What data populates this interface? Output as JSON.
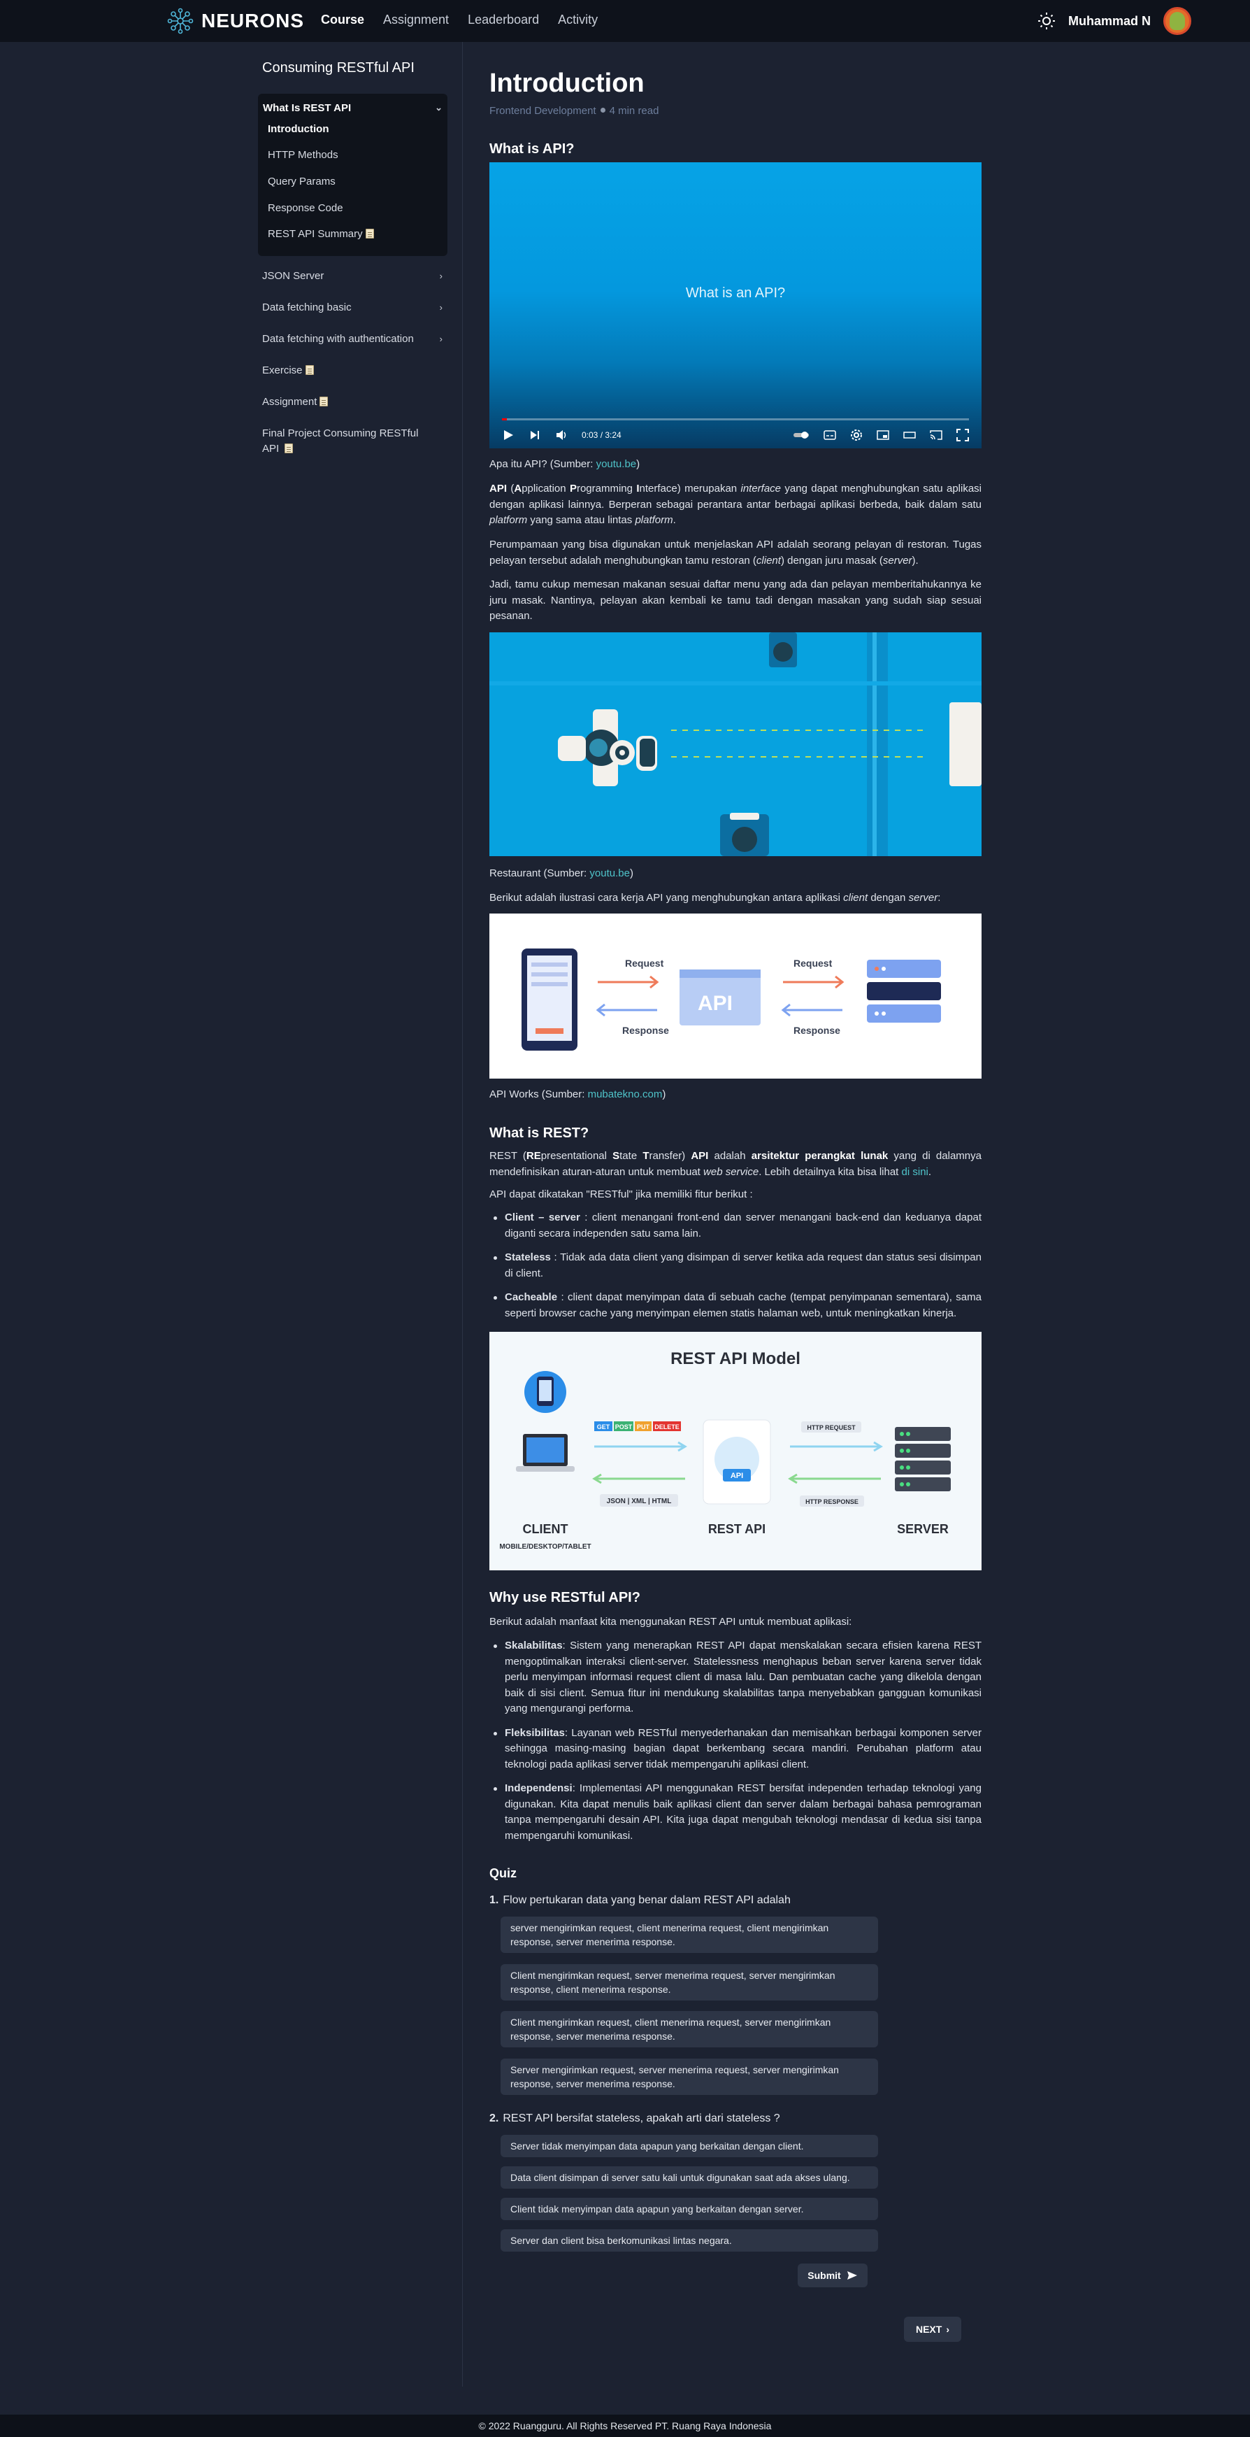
{
  "nav": {
    "brand": "NEURONS",
    "links": [
      "Course",
      "Assignment",
      "Leaderboard",
      "Activity"
    ],
    "user_name": "Muhammad N"
  },
  "sidebar": {
    "title": "Consuming RESTful API",
    "open_group": "What Is REST API",
    "sub_items": [
      "Introduction",
      "HTTP Methods",
      "Query Params",
      "Response Code",
      "REST API Summary"
    ],
    "items": [
      "JSON Server",
      "Data fetching basic",
      "Data fetching with authentication",
      "Exercise",
      "Assignment",
      "Final Project Consuming RESTful API"
    ]
  },
  "article": {
    "title": "Introduction",
    "category": "Frontend Development",
    "read_time": "4 min read",
    "section1_title": "What is API?",
    "video_title": "What is an API?",
    "video_time": "0:03 / 3:24",
    "video_progress": 0.01,
    "caption1_text": "Apa itu API? (Sumber: ",
    "caption1_link": "youtu.be",
    "caption1_end": ")",
    "p1": {
      "api": "API",
      "l1": "A",
      "t1": "pplication ",
      "l2": "P",
      "t2": "rogramming ",
      "l3": "I",
      "t3": "nterface) merupakan ",
      "interface": "interface",
      "t4": " yang dapat menghubungkan satu aplikasi dengan aplikasi lainnya. Berperan sebagai perantara antar berbagai aplikasi berbeda, baik dalam satu ",
      "platform1": "platform",
      "t5": " yang sama atau lintas ",
      "platform2": "platform",
      "t6": "."
    },
    "p2": {
      "t1": "Perumpamaan yang bisa digunakan untuk menjelaskan API adalah seorang pelayan di restoran. Tugas pelayan tersebut adalah menghubungkan tamu restoran (",
      "client": "client",
      "t2": ") dengan juru masak (",
      "server": "server",
      "t3": ")."
    },
    "p3": "Jadi, tamu cukup memesan makanan sesuai daftar menu yang ada dan pelayan memberitahukannya ke juru masak. Nantinya, pelayan akan kembali ke tamu tadi dengan masakan yang sudah siap sesuai pesanan.",
    "caption2_text": "Restaurant (Sumber: ",
    "caption2_link": "youtu.be",
    "caption2_end": ")",
    "p4": {
      "t1": "Berikut adalah ilustrasi cara kerja API yang menghubungkan antara aplikasi ",
      "client": "client",
      "t2": " dengan ",
      "server": "server",
      "t3": ":"
    },
    "api_diagram": {
      "request": "Request",
      "response": "Response",
      "api": "API"
    },
    "caption3_text": "API Works (Sumber: ",
    "caption3_link": "mubatekno.com",
    "caption3_end": ")",
    "section2_title": "What is REST?",
    "p5": {
      "t0": "REST (",
      "re": "RE",
      "t1": "presentational ",
      "s": "S",
      "t2": "tate ",
      "t": "T",
      "t3": "ransfer) ",
      "api": "API",
      "t4": " adalah ",
      "arsitektur": "arsitektur perangkat lunak",
      "t5": " yang di dalamnya mendefinisikan aturan-aturan untuk membuat ",
      "webservice": "web service",
      "t6": ". Lebih detailnya kita bisa lihat ",
      "link": "di sini",
      "t7": "."
    },
    "p6": "API dapat dikatakan \"RESTful\" jika memiliki fitur berikut :",
    "features": [
      {
        "term": "Client – server",
        "text": " : client menangani front-end dan server menangani back-end dan keduanya dapat diganti secara independen satu sama lain."
      },
      {
        "term": "Stateless",
        "text": " : Tidak ada data client yang disimpan di server ketika ada request dan status sesi disimpan di client."
      },
      {
        "term": "Cacheable",
        "text": " : client dapat menyimpan data di sebuah cache (tempat penyimpanan sementara), sama seperti browser cache yang menyimpan elemen statis halaman web, untuk meningkatkan kinerja."
      }
    ],
    "rest_model": {
      "title": "REST API Model",
      "methods": [
        "GET",
        "POST",
        "PUT",
        "DELETE"
      ],
      "formats": "JSON | XML | HTML",
      "http_request": "HTTP REQUEST",
      "http_response": "HTTP RESPONSE",
      "api_badge": "API",
      "client": "CLIENT",
      "client_sub": "MOBILE/DESKTOP/TABLET",
      "rest_api": "REST API",
      "server": "SERVER"
    },
    "section3_title": "Why use RESTful API?",
    "p7": "Berikut adalah manfaat kita menggunakan REST API untuk membuat aplikasi:",
    "benefits": [
      {
        "term": "Skalabilitas",
        "text": ": Sistem yang menerapkan REST API dapat menskalakan secara efisien karena REST mengoptimalkan interaksi client-server. Statelessness menghapus beban server karena server tidak perlu menyimpan informasi request client di masa lalu. Dan pembuatan cache yang dikelola dengan baik di sisi client. Semua fitur ini mendukung skalabilitas tanpa menyebabkan gangguan komunikasi yang mengurangi performa."
      },
      {
        "term": "Fleksibilitas",
        "text": ": Layanan web RESTful menyederhanakan dan memisahkan berbagai komponen server sehingga masing-masing bagian dapat berkembang secara mandiri. Perubahan platform atau teknologi pada aplikasi server tidak mempengaruhi aplikasi client."
      },
      {
        "term": "Independensi",
        "text": ": Implementasi API menggunakan REST bersifat independen terhadap teknologi yang digunakan. Kita dapat menulis baik aplikasi client dan server dalam berbagai bahasa pemrograman tanpa mempengaruhi desain API. Kita juga dapat mengubah teknologi mendasar di kedua sisi tanpa mempengaruhi komunikasi."
      }
    ]
  },
  "quiz": {
    "title": "Quiz",
    "questions": [
      {
        "num": "1.",
        "text": "Flow pertukaran data yang benar dalam REST API adalah",
        "options": [
          "server mengirimkan request, client menerima request, client mengirimkan response, server menerima response.",
          "Client mengirimkan request, server menerima request, server mengirimkan response, client menerima response.",
          "Client mengirimkan request, client menerima request, server mengirimkan response, server menerima response.",
          "Server mengirimkan request, server menerima request, server mengirimkan response, server menerima response."
        ]
      },
      {
        "num": "2.",
        "text": "REST API bersifat stateless, apakah arti dari stateless ?",
        "options": [
          "Server tidak menyimpan data apapun yang berkaitan dengan client.",
          "Data client disimpan di server satu kali untuk digunakan saat ada akses ulang.",
          "Client tidak menyimpan data apapun yang berkaitan dengan server.",
          "Server dan client bisa berkomunikasi lintas negara."
        ]
      }
    ],
    "submit": "Submit",
    "next": "NEXT"
  },
  "footer": "© 2022 Ruangguru. All Rights Reserved PT. Ruang Raya Indonesia",
  "colors": {
    "accent": "#4fc3c9",
    "bg": "#1c2231",
    "nav_bg": "#0e121b",
    "option_bg": "#2d3546"
  }
}
